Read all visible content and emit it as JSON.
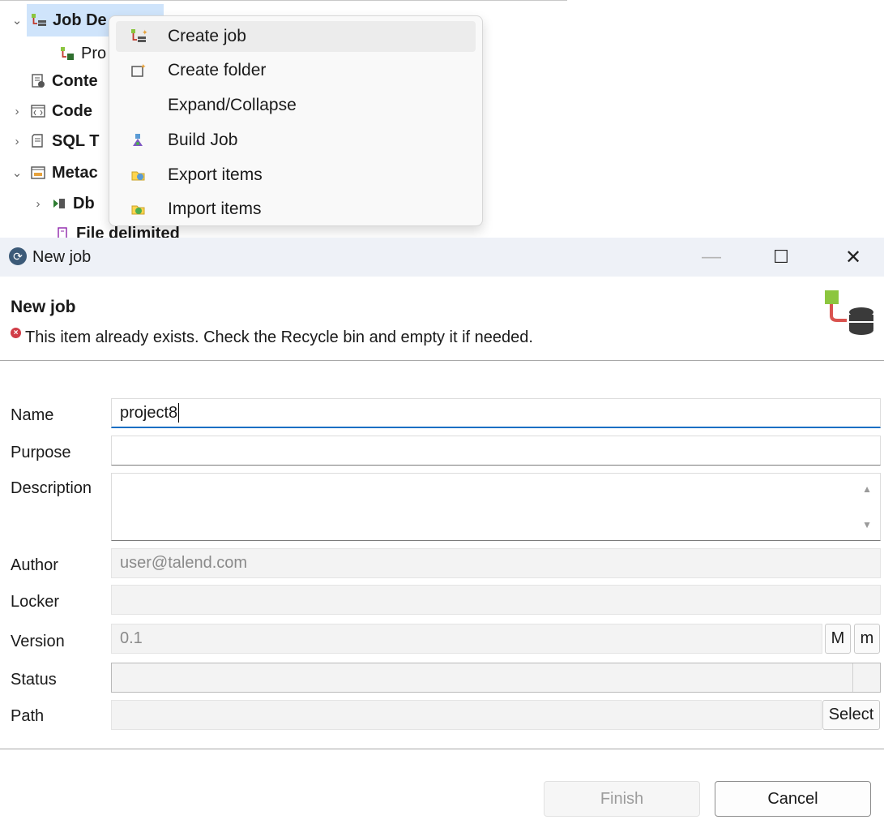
{
  "tree": {
    "items": [
      {
        "label": "Job De"
      },
      {
        "label": "Pro"
      },
      {
        "label": "Conte"
      },
      {
        "label": "Code"
      },
      {
        "label": "SQL T"
      },
      {
        "label": "Metac"
      },
      {
        "label": "Db"
      },
      {
        "label": "File delimited"
      }
    ]
  },
  "context_menu": {
    "items": [
      {
        "label": "Create job",
        "icon": "create-job-icon"
      },
      {
        "label": "Create folder",
        "icon": "create-folder-icon"
      },
      {
        "label": "Expand/Collapse",
        "icon": ""
      },
      {
        "label": "Build Job",
        "icon": "build-job-icon"
      },
      {
        "label": "Export items",
        "icon": "export-items-icon"
      },
      {
        "label": "Import items",
        "icon": "import-items-icon"
      }
    ]
  },
  "dialog": {
    "window_title": "New job",
    "controls": {
      "minimize": "—",
      "maximize": "☐",
      "close": "✕"
    },
    "header_title": "New job",
    "error_message": "This item already exists. Check the Recycle bin and empty it if needed.",
    "fields": {
      "name": {
        "label": "Name",
        "value": "project8"
      },
      "purpose": {
        "label": "Purpose",
        "value": ""
      },
      "description": {
        "label": "Description",
        "value": ""
      },
      "author": {
        "label": "Author",
        "value": "user@talend.com"
      },
      "locker": {
        "label": "Locker",
        "value": ""
      },
      "version": {
        "label": "Version",
        "value": "0.1",
        "major_label": "M",
        "minor_label": "m"
      },
      "status": {
        "label": "Status",
        "value": ""
      },
      "path": {
        "label": "Path",
        "value": "",
        "select_label": "Select"
      }
    },
    "buttons": {
      "finish": "Finish",
      "cancel": "Cancel"
    }
  },
  "colors": {
    "accent": "#1a6fc4",
    "error": "#d13d48",
    "selection": "#cfe4fb"
  }
}
